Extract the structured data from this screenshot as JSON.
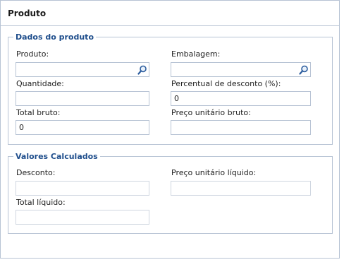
{
  "window": {
    "title": "Produto"
  },
  "dados": {
    "legend": "Dados do produto",
    "produto": {
      "label": "Produto:",
      "value": ""
    },
    "embalagem": {
      "label": "Embalagem:",
      "value": ""
    },
    "quantidade": {
      "label": "Quantidade:",
      "value": ""
    },
    "percentual_desconto": {
      "label": "Percentual de desconto (%):",
      "value": "0"
    },
    "total_bruto": {
      "label": "Total bruto:",
      "value": "0"
    },
    "preco_unitario_bruto": {
      "label": "Preço unitário bruto:",
      "value": ""
    }
  },
  "valores": {
    "legend": "Valores Calculados",
    "desconto": {
      "label": "Desconto:",
      "value": ""
    },
    "preco_unitario_liquido": {
      "label": "Preço unitário líquido:",
      "value": ""
    },
    "total_liquido": {
      "label": "Total líquido:",
      "value": ""
    }
  },
  "icons": {
    "lookup": "magnifier-icon"
  },
  "colors": {
    "accent": "#1f4e8c",
    "border": "#b7c3d4"
  }
}
